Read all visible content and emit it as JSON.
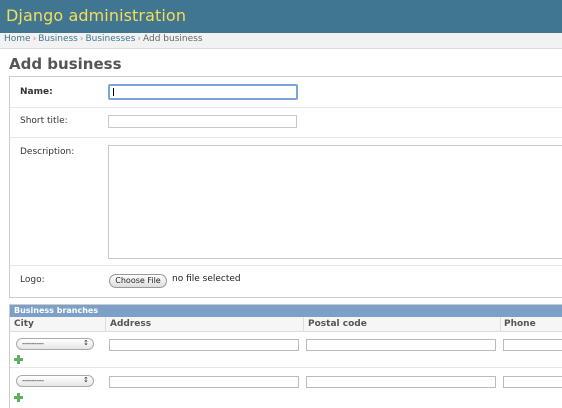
{
  "header": {
    "title": "Django administration"
  },
  "breadcrumbs": {
    "home": "Home",
    "app": "Business",
    "model": "Businesses",
    "current": "Add business",
    "separator": "›"
  },
  "page": {
    "title": "Add business"
  },
  "form": {
    "fields": {
      "name": {
        "label": "Name:",
        "value": ""
      },
      "short_title": {
        "label": "Short title:",
        "value": ""
      },
      "description": {
        "label": "Description:",
        "value": ""
      },
      "logo": {
        "label": "Logo:",
        "button": "Choose File",
        "status": "no file selected"
      }
    }
  },
  "inline": {
    "title": "Business branches",
    "columns": [
      "City",
      "Address",
      "Postal code",
      "Phone"
    ],
    "rows": [
      {
        "city": "---------",
        "address": "",
        "postal_code": "",
        "phone": ""
      },
      {
        "city": "---------",
        "address": "",
        "postal_code": "",
        "phone": ""
      }
    ]
  },
  "colors": {
    "header_bg": "#417690",
    "brand": "#f5dd5d",
    "inline_header_bg": "#7ca0c7",
    "link": "#417690",
    "add_icon": "#5fb05f"
  },
  "icons": {
    "add": "plus-icon",
    "select_arrows": "updown-arrows-icon"
  }
}
